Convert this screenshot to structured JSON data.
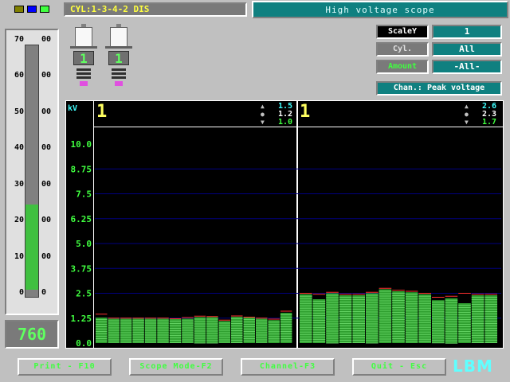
{
  "topbar": {
    "indicator_colors": [
      "#808000",
      "#0000ff",
      "#40ff40"
    ],
    "cyl_text": "CYL:1-3-4-2 DIS",
    "title": "High voltage scope"
  },
  "gauge": {
    "left_ticks": [
      "70",
      "60",
      "50",
      "40",
      "30",
      "20",
      "10",
      "0"
    ],
    "right_ticks": [
      "00",
      "00",
      "00",
      "00",
      "00",
      "00",
      "00",
      "0"
    ],
    "fill_fraction": 0.1,
    "rpm": "760",
    "fill_color": "#40c040"
  },
  "plugs": [
    {
      "number": "1"
    },
    {
      "number": "1"
    }
  ],
  "controls": {
    "scale_label": "ScaleY",
    "scale_value": "1",
    "cyl_label": "Cyl.",
    "cyl_value": "All",
    "amount_label": "Amount",
    "amount_value": "-All-",
    "channel_label": "Chan.: Peak voltage"
  },
  "scope": {
    "unit": "kV",
    "yticks": [
      "10.0",
      "8.75",
      "7.5",
      "6.25",
      "5.0",
      "3.75",
      "2.5",
      "1.25",
      "0.0"
    ],
    "ylim": [
      0,
      10.0
    ],
    "channels": [
      {
        "number": "1",
        "max": "1.5",
        "avg": "1.2",
        "min": "1.0",
        "bars": [
          1.28,
          1.22,
          1.22,
          1.23,
          1.22,
          1.22,
          1.2,
          1.22,
          1.3,
          1.3,
          1.1,
          1.32,
          1.28,
          1.22,
          1.15,
          1.52
        ],
        "peaks": [
          1.45,
          1.25,
          1.25,
          1.25,
          1.25,
          1.25,
          1.22,
          1.28,
          1.35,
          1.33,
          1.15,
          1.36,
          1.3,
          1.25,
          1.2,
          1.6
        ]
      },
      {
        "number": "1",
        "max": "2.6",
        "avg": "2.3",
        "min": "1.7",
        "bars": [
          2.45,
          2.2,
          2.5,
          2.4,
          2.4,
          2.5,
          2.7,
          2.6,
          2.55,
          2.45,
          2.15,
          2.25,
          2.0,
          2.4,
          2.4
        ],
        "peaks": [
          2.5,
          2.45,
          2.55,
          2.45,
          2.45,
          2.55,
          2.75,
          2.65,
          2.6,
          2.5,
          2.3,
          2.35,
          2.5,
          2.45,
          2.45
        ]
      }
    ]
  },
  "buttons": {
    "print": "Print - F10",
    "scope_mode": "Scope Mode-F2",
    "channel": "Channel-F3",
    "quit": "Quit - Esc"
  },
  "logo": "LBM"
}
